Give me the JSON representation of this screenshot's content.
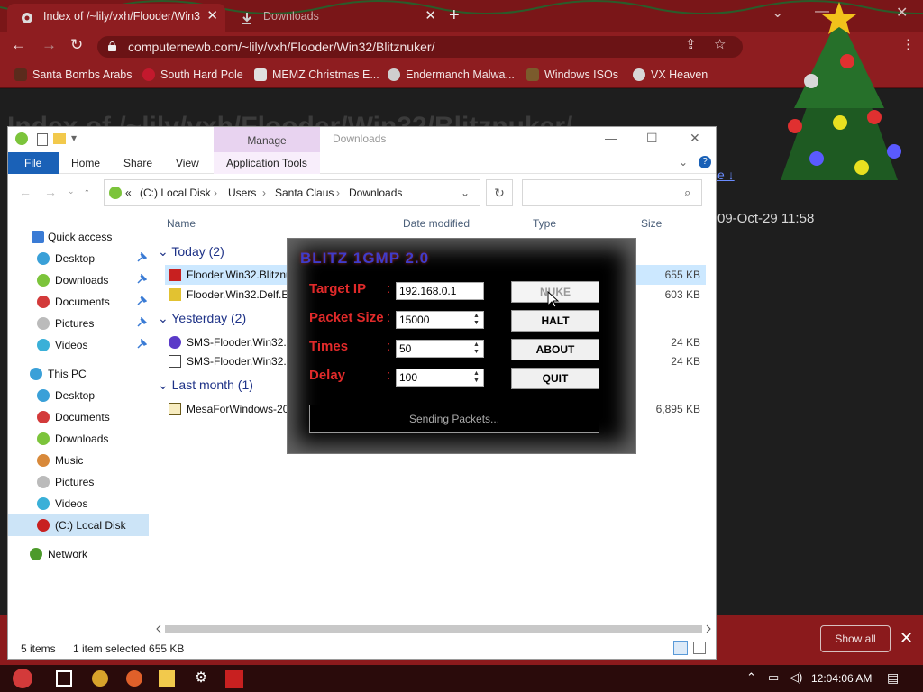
{
  "browser": {
    "tabs": [
      {
        "title": "Index of /~lily/vxh/Flooder/Win3",
        "close": "✕"
      },
      {
        "title": "Downloads",
        "close": "✕"
      }
    ],
    "new_tab": "+",
    "url": "computernewb.com/~lily/vxh/Flooder/Win32/Blitznuker/",
    "bookmarks": [
      {
        "label": "Santa Bombs Arabs",
        "color": "#5a2b1c"
      },
      {
        "label": "South Hard Pole",
        "color": "#c3192d"
      },
      {
        "label": "MEMZ Christmas E...",
        "color": "#e0e0e0"
      },
      {
        "label": "Endermanch Malwa...",
        "color": "#cfcfcf"
      },
      {
        "label": "Windows ISOs",
        "color": "#7b5b2c"
      },
      {
        "label": "VX Heaven",
        "color": "#d7d7d7"
      }
    ]
  },
  "page": {
    "title": "Index of /~lily/vxh/Flooder/Win32/Blitznuker/",
    "date": "09-Oct-29 11:58",
    "link": "e ↓",
    "show_all": "Show all",
    "close": "✕"
  },
  "explorer": {
    "manage": "Manage",
    "window_title": "Downloads",
    "ribbon": {
      "file": "File",
      "home": "Home",
      "share": "Share",
      "view": "View",
      "app_tools": "Application Tools"
    },
    "breadcrumb": [
      "(C:) Local Disk",
      "Users",
      "Santa Claus",
      "Downloads"
    ],
    "columns": {
      "name": "Name",
      "date": "Date modified",
      "type": "Type",
      "size": "Size"
    },
    "nav": [
      {
        "label": "Quick access",
        "color": "#3a7bd5"
      },
      {
        "label": "Desktop",
        "color": "#3aa0d8"
      },
      {
        "label": "Downloads",
        "color": "#7cc43b"
      },
      {
        "label": "Documents",
        "color": "#d33a3a"
      },
      {
        "label": "Pictures",
        "color": "#bbbbbb"
      },
      {
        "label": "Videos",
        "color": "#3ab0d8"
      },
      {
        "label": "This PC",
        "color": "#3aa0d8"
      },
      {
        "label": "Desktop",
        "color": "#3aa0d8"
      },
      {
        "label": "Documents",
        "color": "#d33a3a"
      },
      {
        "label": "Downloads",
        "color": "#7cc43b"
      },
      {
        "label": "Music",
        "color": "#d8893a"
      },
      {
        "label": "Pictures",
        "color": "#bbbbbb"
      },
      {
        "label": "Videos",
        "color": "#3ab0d8"
      },
      {
        "label": "(C:) Local Disk",
        "color": "#c82020"
      },
      {
        "label": "Network",
        "color": "#4c9a2a"
      }
    ],
    "groups": [
      {
        "label": "Today (2)"
      },
      {
        "label": "Yesterday (2)"
      },
      {
        "label": "Last month (1)"
      }
    ],
    "files": [
      {
        "name": "Flooder.Win32.Blitznu",
        "size": "655 KB"
      },
      {
        "name": "Flooder.Win32.Delf.Ex",
        "size": "603 KB"
      },
      {
        "name": "SMS-Flooder.Win32.E",
        "size": "24 KB"
      },
      {
        "name": "SMS-Flooder.Win32.E",
        "size": "24 KB"
      },
      {
        "name": "MesaForWindows-20",
        "size": "6,895 KB"
      }
    ],
    "status": {
      "items": "5 items",
      "selected": "1 item selected  655 KB"
    }
  },
  "blitz": {
    "title": "BLITZ 1GMP 2.0",
    "fields": [
      {
        "label": "Target IP",
        "value": "192.168.0.1"
      },
      {
        "label": "Packet Size",
        "value": "15000"
      },
      {
        "label": "Times",
        "value": "50"
      },
      {
        "label": "Delay",
        "value": "100"
      }
    ],
    "colon": ":",
    "buttons": {
      "nuke": "NUKE",
      "halt": "HALT",
      "about": "ABOUT",
      "quit": "QUIT"
    },
    "status": "Sending Packets..."
  },
  "taskbar": {
    "time": "12:04:06 AM"
  }
}
